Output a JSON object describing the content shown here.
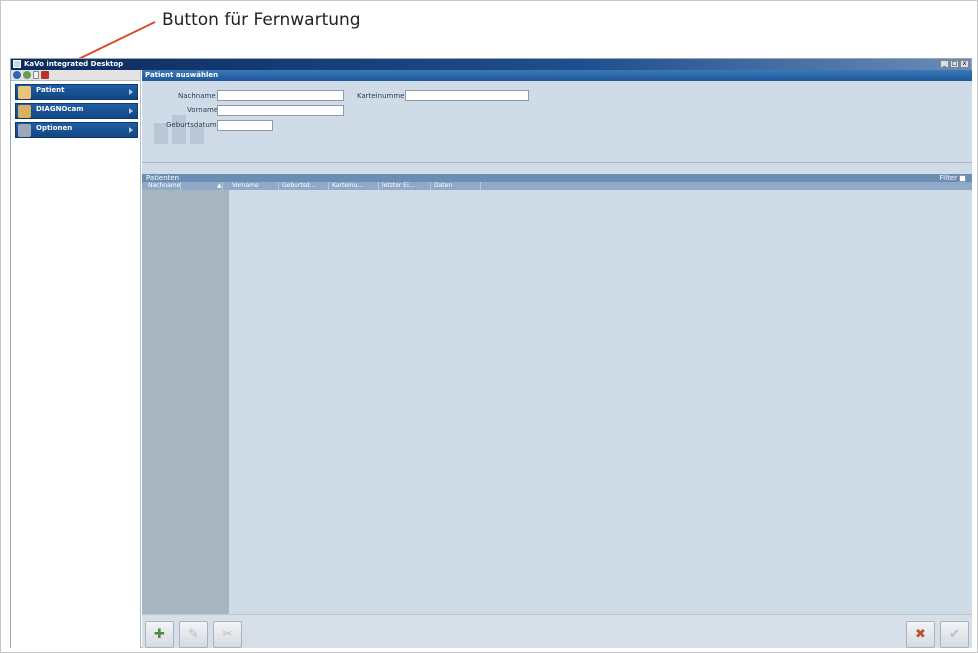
{
  "annotation": {
    "text": "Button für Fernwartung"
  },
  "window": {
    "title": "KaVo integrated Desktop",
    "controls": [
      "_",
      "□",
      "x"
    ]
  },
  "sidebar": {
    "toolbar_icons": [
      "info-icon",
      "status-icon",
      "document-icon",
      "remote-maintenance-icon"
    ],
    "items": [
      {
        "label": "Patient",
        "icon": "patient-icon"
      },
      {
        "label": "DIAGNOcam",
        "icon": "diagnocam-icon"
      },
      {
        "label": "Optionen",
        "icon": "options-icon"
      }
    ]
  },
  "search": {
    "title": "Patient auswählen",
    "nachname_label": "Nachname",
    "vorname_label": "Vorname",
    "geburtsdatum_label": "Geburtsdatum",
    "karteinummer_label": "Karteinummer",
    "nachname_value": "",
    "vorname_value": "",
    "geburtsdatum_value": "",
    "karteinummer_value": ""
  },
  "list": {
    "title": "Patienten",
    "filter_label": "Filter",
    "columns": [
      "Nachname",
      "Vorname",
      "Geburtsd...",
      "Karteinu...",
      "letzter Ei...",
      "Daten"
    ],
    "sort_indicator": "▲"
  },
  "buttons": {
    "add": "add-patient-icon",
    "edit": "edit-patient-icon",
    "delete": "delete-patient-icon",
    "cancel": "cancel-icon",
    "confirm": "confirm-icon"
  },
  "colors": {
    "accent": "#1d5898",
    "panel": "#cfdce8",
    "cancel": "#c0503a"
  }
}
